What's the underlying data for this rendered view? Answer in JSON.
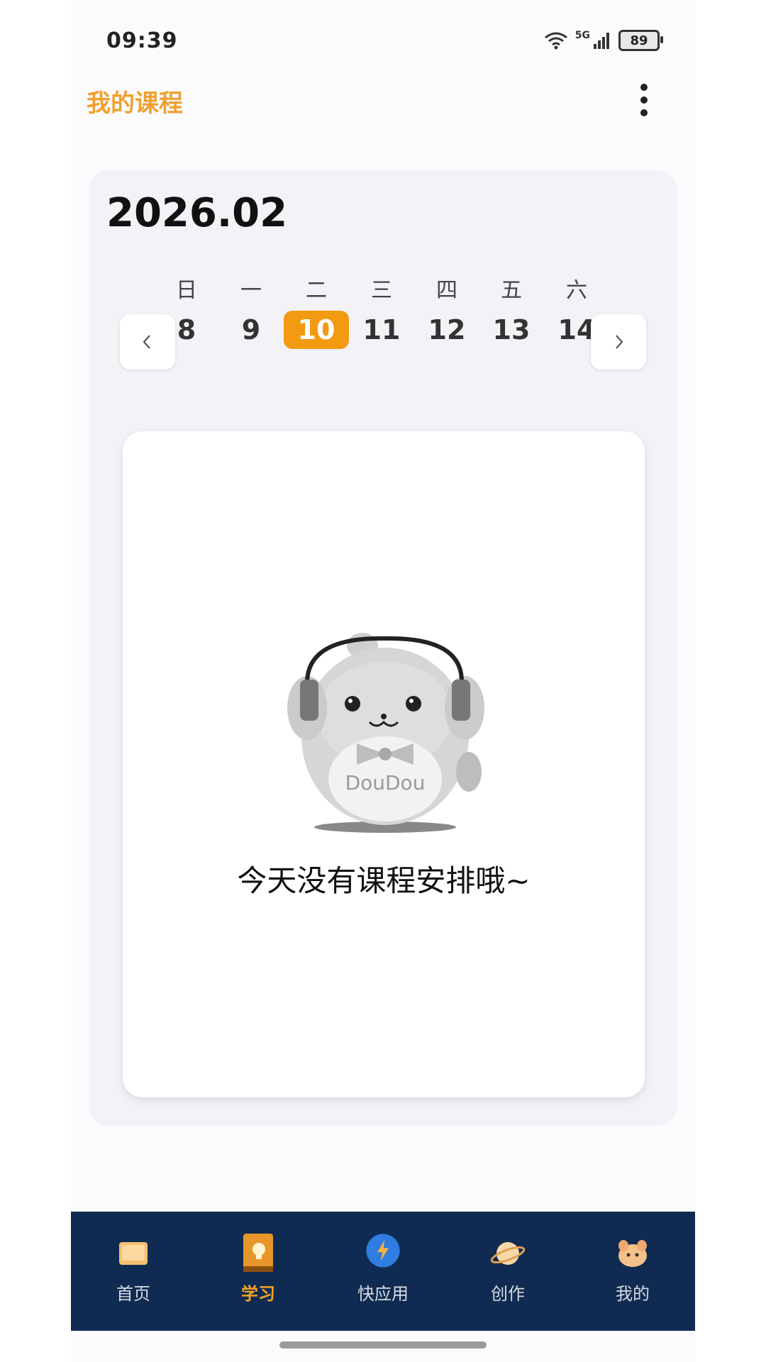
{
  "status_bar": {
    "time": "09:39",
    "network": "5G",
    "battery": "89"
  },
  "app_bar": {
    "title": "我的课程"
  },
  "calendar": {
    "month_label": "2026.02",
    "days": [
      {
        "weekday": "日",
        "date": "8"
      },
      {
        "weekday": "一",
        "date": "9"
      },
      {
        "weekday": "二",
        "date": "10",
        "selected": true
      },
      {
        "weekday": "三",
        "date": "11"
      },
      {
        "weekday": "四",
        "date": "12"
      },
      {
        "weekday": "五",
        "date": "13"
      },
      {
        "weekday": "六",
        "date": "14"
      }
    ]
  },
  "empty_state": {
    "message": "今天没有课程安排哦~",
    "mascot_badge": "DouDou"
  },
  "bottom_nav": [
    {
      "label": "首页",
      "icon": "home-icon"
    },
    {
      "label": "学习",
      "icon": "study-book-icon",
      "active": true
    },
    {
      "label": "快应用",
      "icon": "quick-app-bolt-icon"
    },
    {
      "label": "创作",
      "icon": "planet-icon"
    },
    {
      "label": "我的",
      "icon": "profile-avatar-icon"
    }
  ],
  "colors": {
    "accent": "#f29a12",
    "title": "#f0a030",
    "nav_bg": "#102b52"
  }
}
